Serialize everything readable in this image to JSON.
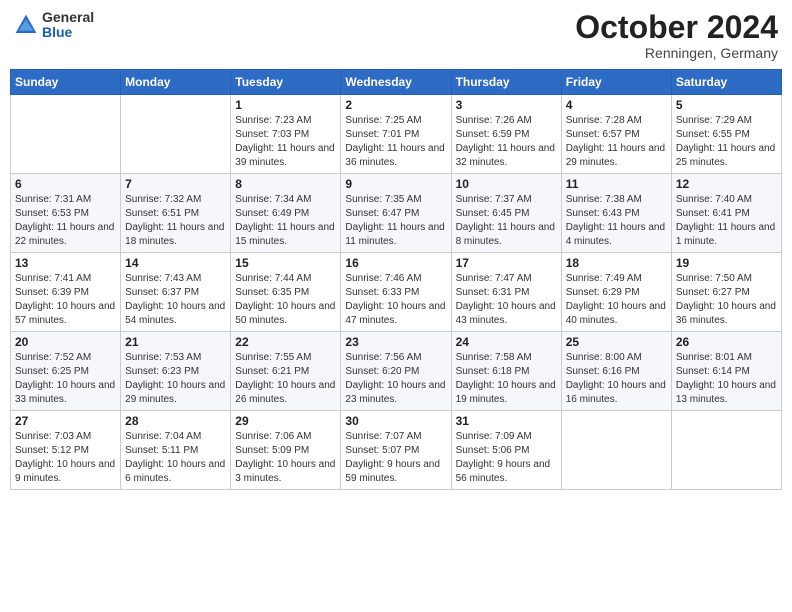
{
  "header": {
    "logo_general": "General",
    "logo_blue": "Blue",
    "month_title": "October 2024",
    "location": "Renningen, Germany"
  },
  "weekdays": [
    "Sunday",
    "Monday",
    "Tuesday",
    "Wednesday",
    "Thursday",
    "Friday",
    "Saturday"
  ],
  "weeks": [
    [
      {
        "day": "",
        "info": ""
      },
      {
        "day": "",
        "info": ""
      },
      {
        "day": "1",
        "info": "Sunrise: 7:23 AM\nSunset: 7:03 PM\nDaylight: 11 hours and 39 minutes."
      },
      {
        "day": "2",
        "info": "Sunrise: 7:25 AM\nSunset: 7:01 PM\nDaylight: 11 hours and 36 minutes."
      },
      {
        "day": "3",
        "info": "Sunrise: 7:26 AM\nSunset: 6:59 PM\nDaylight: 11 hours and 32 minutes."
      },
      {
        "day": "4",
        "info": "Sunrise: 7:28 AM\nSunset: 6:57 PM\nDaylight: 11 hours and 29 minutes."
      },
      {
        "day": "5",
        "info": "Sunrise: 7:29 AM\nSunset: 6:55 PM\nDaylight: 11 hours and 25 minutes."
      }
    ],
    [
      {
        "day": "6",
        "info": "Sunrise: 7:31 AM\nSunset: 6:53 PM\nDaylight: 11 hours and 22 minutes."
      },
      {
        "day": "7",
        "info": "Sunrise: 7:32 AM\nSunset: 6:51 PM\nDaylight: 11 hours and 18 minutes."
      },
      {
        "day": "8",
        "info": "Sunrise: 7:34 AM\nSunset: 6:49 PM\nDaylight: 11 hours and 15 minutes."
      },
      {
        "day": "9",
        "info": "Sunrise: 7:35 AM\nSunset: 6:47 PM\nDaylight: 11 hours and 11 minutes."
      },
      {
        "day": "10",
        "info": "Sunrise: 7:37 AM\nSunset: 6:45 PM\nDaylight: 11 hours and 8 minutes."
      },
      {
        "day": "11",
        "info": "Sunrise: 7:38 AM\nSunset: 6:43 PM\nDaylight: 11 hours and 4 minutes."
      },
      {
        "day": "12",
        "info": "Sunrise: 7:40 AM\nSunset: 6:41 PM\nDaylight: 11 hours and 1 minute."
      }
    ],
    [
      {
        "day": "13",
        "info": "Sunrise: 7:41 AM\nSunset: 6:39 PM\nDaylight: 10 hours and 57 minutes."
      },
      {
        "day": "14",
        "info": "Sunrise: 7:43 AM\nSunset: 6:37 PM\nDaylight: 10 hours and 54 minutes."
      },
      {
        "day": "15",
        "info": "Sunrise: 7:44 AM\nSunset: 6:35 PM\nDaylight: 10 hours and 50 minutes."
      },
      {
        "day": "16",
        "info": "Sunrise: 7:46 AM\nSunset: 6:33 PM\nDaylight: 10 hours and 47 minutes."
      },
      {
        "day": "17",
        "info": "Sunrise: 7:47 AM\nSunset: 6:31 PM\nDaylight: 10 hours and 43 minutes."
      },
      {
        "day": "18",
        "info": "Sunrise: 7:49 AM\nSunset: 6:29 PM\nDaylight: 10 hours and 40 minutes."
      },
      {
        "day": "19",
        "info": "Sunrise: 7:50 AM\nSunset: 6:27 PM\nDaylight: 10 hours and 36 minutes."
      }
    ],
    [
      {
        "day": "20",
        "info": "Sunrise: 7:52 AM\nSunset: 6:25 PM\nDaylight: 10 hours and 33 minutes."
      },
      {
        "day": "21",
        "info": "Sunrise: 7:53 AM\nSunset: 6:23 PM\nDaylight: 10 hours and 29 minutes."
      },
      {
        "day": "22",
        "info": "Sunrise: 7:55 AM\nSunset: 6:21 PM\nDaylight: 10 hours and 26 minutes."
      },
      {
        "day": "23",
        "info": "Sunrise: 7:56 AM\nSunset: 6:20 PM\nDaylight: 10 hours and 23 minutes."
      },
      {
        "day": "24",
        "info": "Sunrise: 7:58 AM\nSunset: 6:18 PM\nDaylight: 10 hours and 19 minutes."
      },
      {
        "day": "25",
        "info": "Sunrise: 8:00 AM\nSunset: 6:16 PM\nDaylight: 10 hours and 16 minutes."
      },
      {
        "day": "26",
        "info": "Sunrise: 8:01 AM\nSunset: 6:14 PM\nDaylight: 10 hours and 13 minutes."
      }
    ],
    [
      {
        "day": "27",
        "info": "Sunrise: 7:03 AM\nSunset: 5:12 PM\nDaylight: 10 hours and 9 minutes."
      },
      {
        "day": "28",
        "info": "Sunrise: 7:04 AM\nSunset: 5:11 PM\nDaylight: 10 hours and 6 minutes."
      },
      {
        "day": "29",
        "info": "Sunrise: 7:06 AM\nSunset: 5:09 PM\nDaylight: 10 hours and 3 minutes."
      },
      {
        "day": "30",
        "info": "Sunrise: 7:07 AM\nSunset: 5:07 PM\nDaylight: 9 hours and 59 minutes."
      },
      {
        "day": "31",
        "info": "Sunrise: 7:09 AM\nSunset: 5:06 PM\nDaylight: 9 hours and 56 minutes."
      },
      {
        "day": "",
        "info": ""
      },
      {
        "day": "",
        "info": ""
      }
    ]
  ]
}
